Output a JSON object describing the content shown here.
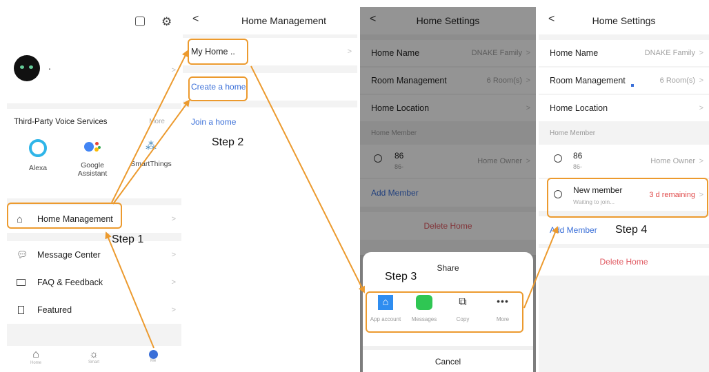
{
  "screen1": {
    "icons": [
      "scan-icon",
      "settings-icon"
    ],
    "profile_name": ".",
    "voice_section_title": "Third-Party Voice Services",
    "voice_more": "More",
    "voice_services": [
      {
        "name": "Alexa"
      },
      {
        "name": "Google Assistant"
      },
      {
        "name": "SmartThings"
      }
    ],
    "menu": [
      {
        "label": "Home Management"
      },
      {
        "label": "Message Center"
      },
      {
        "label": "FAQ & Feedback"
      },
      {
        "label": "Featured"
      }
    ],
    "tabbar": [
      "Home",
      "Smart",
      "Me"
    ]
  },
  "screen2": {
    "title": "Home Management",
    "home_item": "My Home ..",
    "create_home": "Create a home",
    "join_home": "Join a home"
  },
  "screen3": {
    "title": "Home Settings",
    "rows": [
      {
        "label": "Home Name",
        "value": "DNAKE Family"
      },
      {
        "label": "Room Management",
        "value": "6 Room(s)"
      },
      {
        "label": "Home Location",
        "value": ""
      }
    ],
    "member_section": "Home Member",
    "member": {
      "name": "86",
      "sub": "86-",
      "role": "Home Owner"
    },
    "add_member": "Add Member",
    "delete_home": "Delete Home",
    "share_title": "Share",
    "share_options": [
      {
        "label": "App account",
        "icon": "home-share-icon"
      },
      {
        "label": "Messages",
        "icon": "message-icon"
      },
      {
        "label": "Copy",
        "icon": "copy-icon"
      },
      {
        "label": "More",
        "icon": "more-icon"
      }
    ],
    "cancel": "Cancel"
  },
  "screen4": {
    "title": "Home Settings",
    "rows": [
      {
        "label": "Home Name",
        "value": "DNAKE Family"
      },
      {
        "label": "Room Management",
        "value": "6 Room(s)"
      },
      {
        "label": "Home Location",
        "value": ""
      }
    ],
    "member_section": "Home Member",
    "member": {
      "name": "86",
      "sub": "86-",
      "role": "Home Owner"
    },
    "new_member": {
      "name": "New member",
      "sub": "Waiting to join...",
      "status": "3 d remaining"
    },
    "add_member": "Add Member",
    "delete_home": "Delete Home"
  },
  "steps": [
    "Step 1",
    "Step 2",
    "Step 3",
    "Step 4"
  ],
  "colors": {
    "highlight": "#ec9a2e",
    "link": "#3a6fd8",
    "danger": "#e05a62",
    "status": "#e04a4a"
  }
}
